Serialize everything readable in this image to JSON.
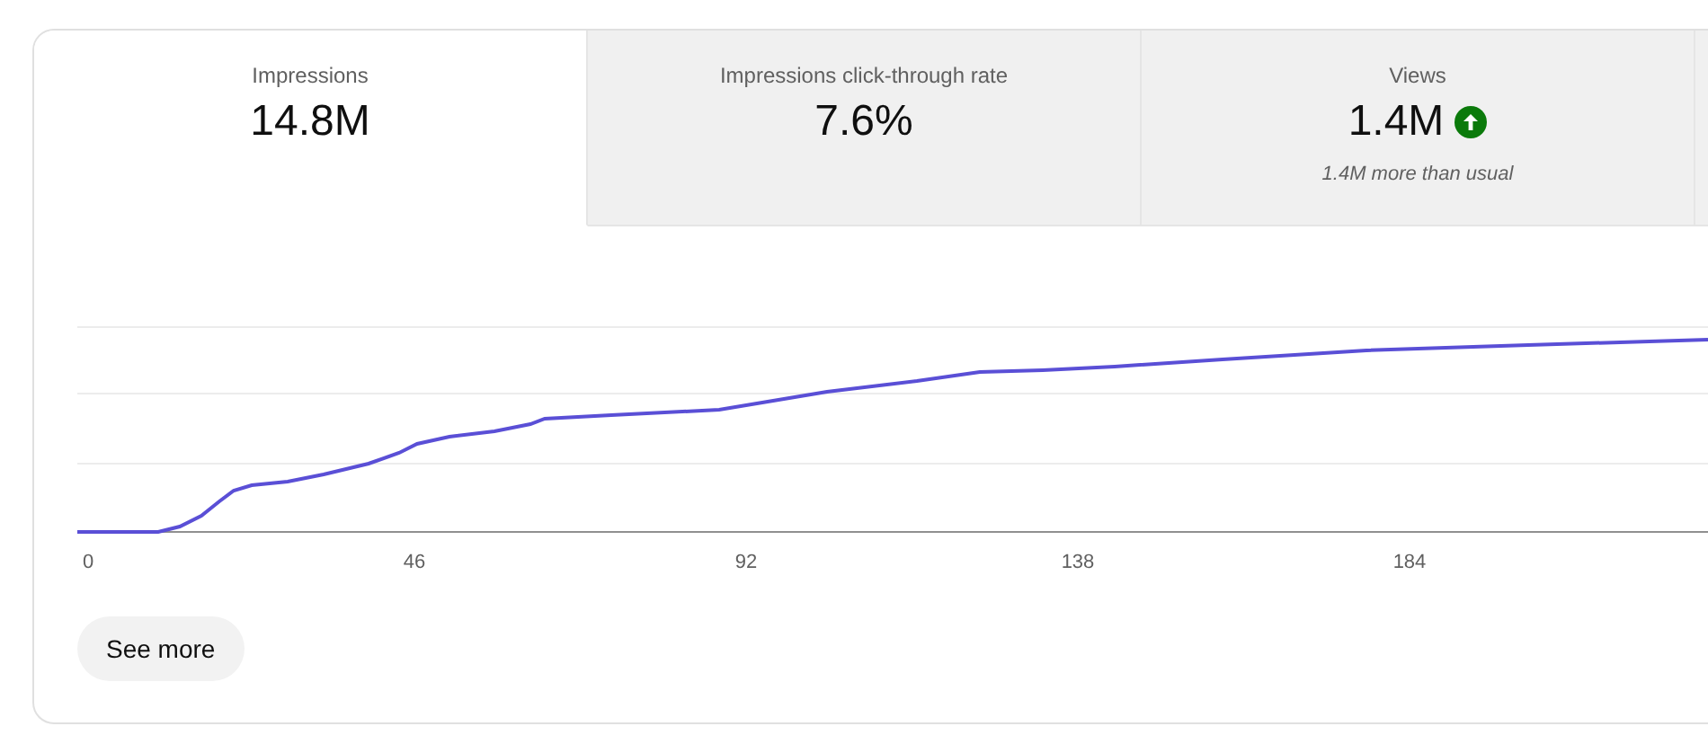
{
  "tabs": [
    {
      "label": "Impressions",
      "value": "14.8M",
      "selected": true
    },
    {
      "label": "Impressions click-through rate",
      "value": "7.6%",
      "selected": false
    },
    {
      "label": "Views",
      "value": "1.4M",
      "trending_up": true,
      "note": "1.4M more than usual",
      "selected": false
    }
  ],
  "chart": {
    "x_tick_labels": [
      "0",
      "46",
      "92",
      "138",
      "184"
    ]
  },
  "button": "See more"
}
